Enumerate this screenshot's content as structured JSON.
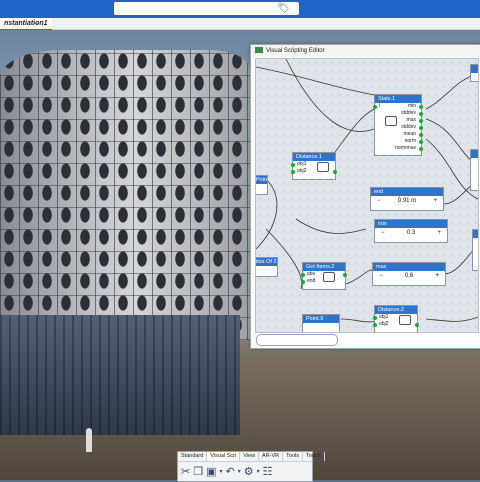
{
  "topbar": {
    "search_value": "",
    "tag_icon": "tag-icon"
  },
  "document_tab": {
    "label": "nstantiation1",
    "add_label": "+"
  },
  "editor": {
    "title": "Visual Scripting Editor",
    "search_placeholder": "",
    "nodes": {
      "stats": {
        "title": "Stats.1",
        "in": "l",
        "outputs": [
          "min",
          "stddev",
          "max",
          "stddev",
          "mean",
          "norm",
          "normmax"
        ]
      },
      "distance1": {
        "title": "Distance.1",
        "inputs": [
          "obj1",
          "obj2"
        ]
      },
      "point5": {
        "title": "Point.5"
      },
      "end": {
        "title": "end",
        "minus": "−",
        "value": "0.91 m",
        "plus": "+"
      },
      "min": {
        "title": "min",
        "minus": "−",
        "value": "0.3",
        "plus": "+"
      },
      "max": {
        "title": "max",
        "minus": "−",
        "value": "0.6",
        "plus": "+"
      },
      "getitems": {
        "title": "Get Items.2",
        "inputs": [
          "obs",
          "end"
        ]
      },
      "listof": {
        "title": "ites Of 2"
      },
      "distance2": {
        "title": "Distance.2",
        "inputs": [
          "obj1",
          "obj2"
        ]
      },
      "point9": {
        "title": "Point.9"
      }
    }
  },
  "toolbar": {
    "tabs": [
      "Standard",
      "Visual Scri",
      "View",
      "AR-VR",
      "Tools",
      "Touch"
    ],
    "icons": [
      "scissors-icon",
      "copy-icon",
      "paste-icon",
      "dropdown-icon",
      "undo-icon",
      "dropdown-icon",
      "settings-icon",
      "dropdown-icon",
      "graph-icon"
    ]
  }
}
